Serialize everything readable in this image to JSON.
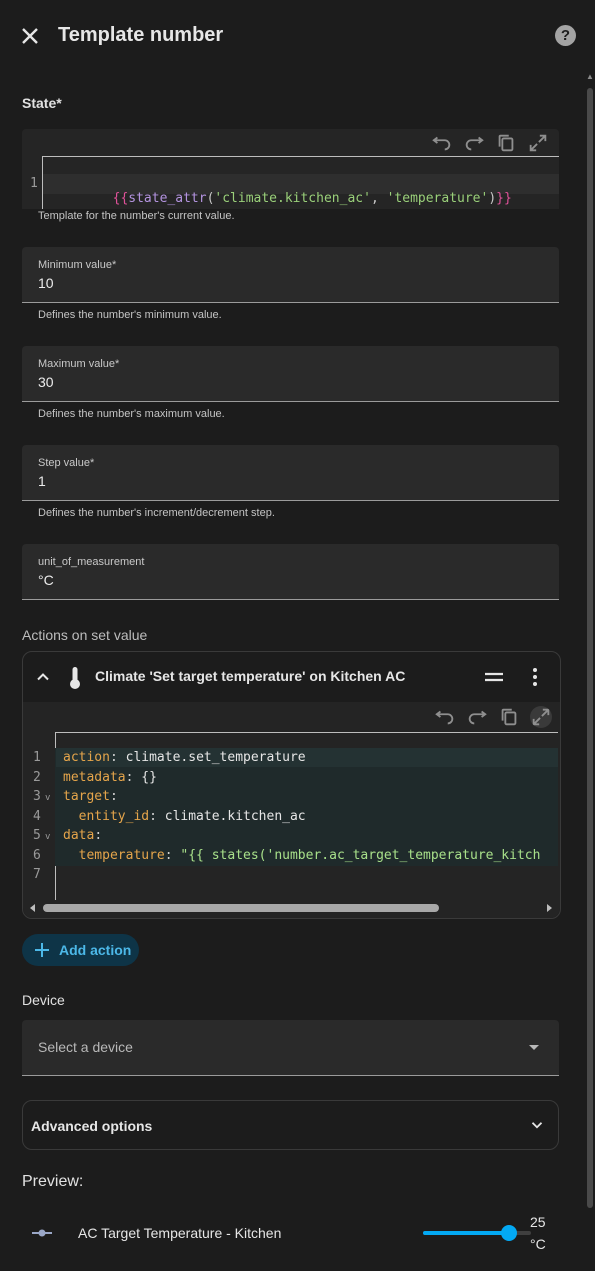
{
  "dialog": {
    "title": "Template number"
  },
  "state": {
    "label": "State*",
    "code_line_number": "1",
    "code_open": "{{",
    "code_func": "state_attr",
    "code_args_open": "(",
    "code_arg1": "'climate.kitchen_ac'",
    "code_comma": ", ",
    "code_arg2": "'temperature'",
    "code_args_close": ")",
    "code_close": "}}",
    "helper": "Template for the number's current value."
  },
  "minimum": {
    "label": "Minimum value*",
    "value": "10",
    "helper": "Defines the number's minimum value."
  },
  "maximum": {
    "label": "Maximum value*",
    "value": "30",
    "helper": "Defines the number's maximum value."
  },
  "step": {
    "label": "Step value*",
    "value": "1",
    "helper": "Defines the number's increment/decrement step."
  },
  "unit": {
    "label": "unit_of_measurement",
    "value": "°C"
  },
  "actions": {
    "section_label": "Actions on set value",
    "card_title": "Climate 'Set target temperature' on Kitchen AC",
    "yaml_lines": [
      {
        "n": "1",
        "key": "action",
        "sep": ": ",
        "val": "climate.set_temperature",
        "fold": ""
      },
      {
        "n": "2",
        "key": "metadata",
        "sep": ": ",
        "val": "{}",
        "fold": ""
      },
      {
        "n": "3",
        "key": "target",
        "sep": ":",
        "val": "",
        "fold": "v"
      },
      {
        "n": "4",
        "key": "  entity_id",
        "sep": ": ",
        "val": "climate.kitchen_ac",
        "fold": ""
      },
      {
        "n": "5",
        "key": "data",
        "sep": ":",
        "val": "",
        "fold": "v"
      },
      {
        "n": "6",
        "key": "  temperature",
        "sep": ": ",
        "val": "\"{{ states('number.ac_target_temperature_kitch",
        "fold": ""
      },
      {
        "n": "7",
        "key": "",
        "sep": "",
        "val": "",
        "fold": ""
      }
    ],
    "add_action_label": "Add action"
  },
  "device": {
    "section_label": "Device",
    "placeholder": "Select a device"
  },
  "advanced": {
    "label": "Advanced options"
  },
  "preview": {
    "label": "Preview:",
    "entity_name": "AC Target Temperature - Kitchen",
    "value": "25",
    "unit": "°C",
    "slider_fraction": 0.8
  },
  "colors": {
    "accent": "#03a9f4",
    "background": "#1c1c1c",
    "field_bg": "#2a2a2a",
    "yaml_key": "#e5a54b",
    "yaml_string": "#a8e08a",
    "template_brace": "#e0529a",
    "template_func": "#b494e0",
    "template_string": "#9ad07a"
  }
}
